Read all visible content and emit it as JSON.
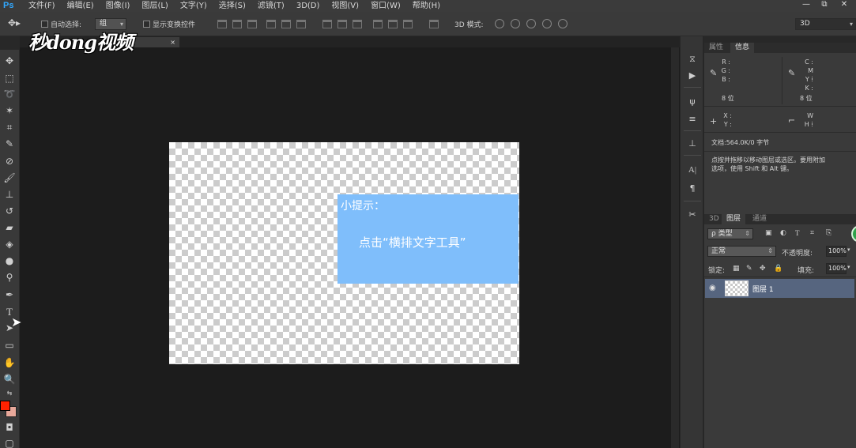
{
  "menubar": {
    "logo": "Ps",
    "items": [
      "文件(F)",
      "编辑(E)",
      "图像(I)",
      "图层(L)",
      "文字(Y)",
      "选择(S)",
      "滤镜(T)",
      "3D(D)",
      "视图(V)",
      "窗口(W)",
      "帮助(H)"
    ],
    "minimize": "—",
    "restore": "⧉",
    "close": "✕"
  },
  "options": {
    "auto_select_label": "自动选择:",
    "auto_select_value": "组",
    "show_transform_label": "显示变换控件",
    "mode_3d_label": "3D 模式:",
    "workspace_value": "3D"
  },
  "watermark": "秒dong视频",
  "document": {
    "tab_close": "×",
    "tip_title": "小提示：",
    "tip_text": "点击“横排文字工具”"
  },
  "info_panel": {
    "tabs": [
      "属性",
      "信息"
    ],
    "rgb_labels": [
      "R :",
      "G :",
      "B :"
    ],
    "cmyk_labels": [
      "C :",
      "M :",
      "Y :",
      "K :"
    ],
    "bit_left": "8 位",
    "bit_right": "8 位",
    "xy_labels": [
      "X :",
      "Y :"
    ],
    "wh_labels": [
      "W :",
      "H :"
    ],
    "doc_size": "文档:564.0K/0 字节",
    "hint_line1": "点按并拖移以移动图层或选区。要用附加",
    "hint_line2": "选项，使用 Shift 和 Alt 键。"
  },
  "layers_panel": {
    "tabs": [
      "3D",
      "图层",
      "通道"
    ],
    "filter_kind": "ρ 类型",
    "blend_mode": "正常",
    "opacity_label": "不透明度:",
    "opacity_value": "100%",
    "lock_label": "锁定:",
    "fill_label": "填充:",
    "fill_value": "100%",
    "layer_name": "图层 1"
  },
  "colors": {
    "foreground": "#ff2200",
    "background": "#e8a89a",
    "tip_box": "#7fbefb",
    "selected_layer": "#56657f"
  }
}
